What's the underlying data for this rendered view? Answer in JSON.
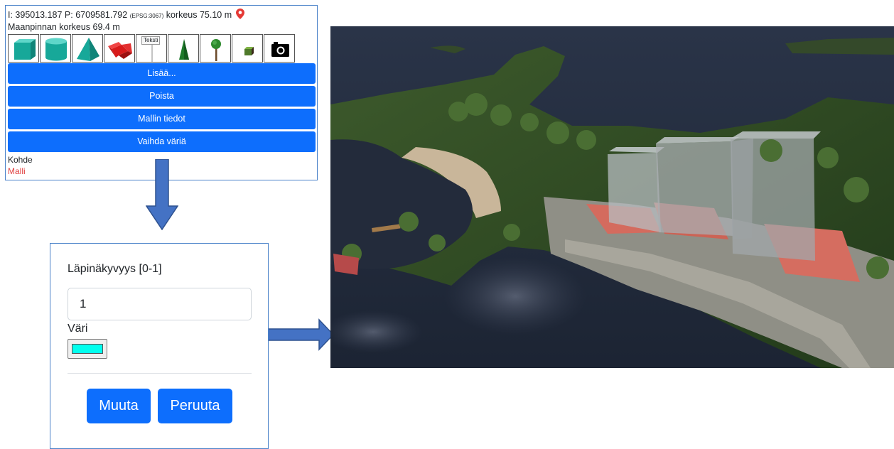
{
  "panel": {
    "coords_main": "I: 395013.187 P: 6709581.792 ",
    "coords_epsg": "(EPSG:3067)",
    "coords_height": " korkeus 75.10 m",
    "ground_height": "Maanpinnan korkeus 69.4 m",
    "text_tool_label": "Teksti",
    "buttons": {
      "add": "Lisää...",
      "remove": "Poista",
      "model_info": "Mallin tiedot",
      "change_color": "Vaihda väriä"
    },
    "target_label": "Kohde",
    "target_value": "Malli"
  },
  "dialog": {
    "opacity_label": "Läpinäkyvyys [0-1]",
    "opacity_value": "1",
    "color_label": "Väri",
    "color_value": "#00ffee",
    "apply": "Muuta",
    "cancel": "Peruuta"
  },
  "icons": [
    "map-pin-icon",
    "cube-icon",
    "cylinder-icon",
    "pyramid-icon",
    "freeform-shape-icon",
    "text-label-icon",
    "cone-tree-icon",
    "round-tree-icon",
    "box-icon",
    "camera-icon"
  ],
  "colors": {
    "accent": "#0d6efd",
    "frame": "#4a82c9",
    "arrow": "#4472c4",
    "pin": "#e53935",
    "shape_teal": "#1fb7a9",
    "shape_red": "#d81b1b"
  }
}
